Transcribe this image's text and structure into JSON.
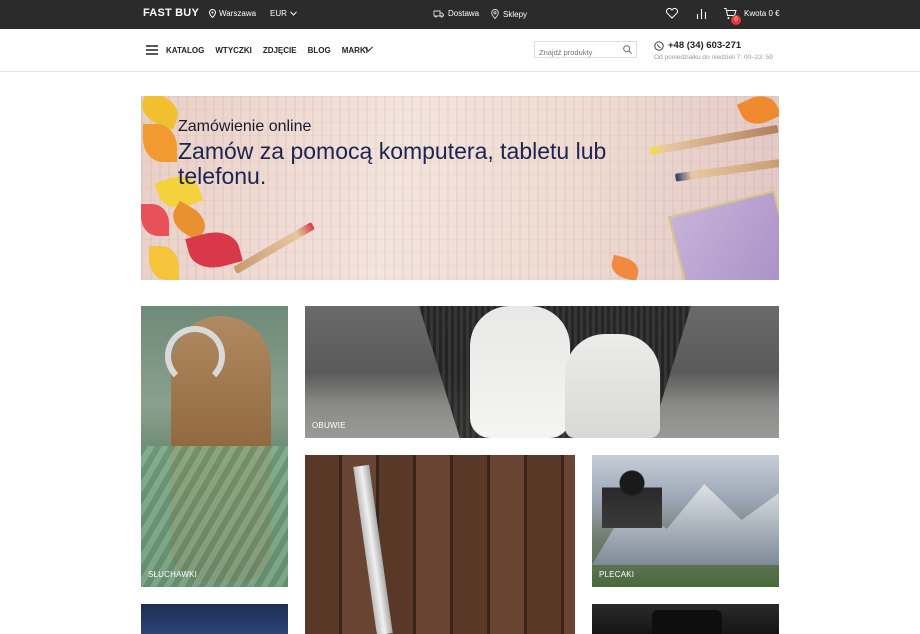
{
  "topbar": {
    "brand": "FAST BUY",
    "location": "Warszawa",
    "currency": "EUR",
    "delivery": "Dostawa",
    "shops": "Sklepy",
    "cart_count": "0",
    "cart_amount": "Kwota 0 €"
  },
  "nav": {
    "items": [
      "KATALOG",
      "WTYCZKI",
      "ZDJĘCIE",
      "BLOG",
      "MARKI"
    ],
    "search_placeholder": "Znajdź produkty",
    "phone": "+48 (34) 603-271",
    "hours": "Od poniedziałku do niedzieli 7: 00–23: 59"
  },
  "banner": {
    "subtitle": "Zamówienie online",
    "title": "Zamów za pomocą komputera, tabletu lub telefonu."
  },
  "tiles": {
    "headphones": "SŁUCHAWKI",
    "shoes": "OBUWIE",
    "backpacks": "PLECAKI"
  },
  "colors": {
    "topbar": "#2b2b2b",
    "badge": "#e53935",
    "banner_title": "#1c2452"
  }
}
